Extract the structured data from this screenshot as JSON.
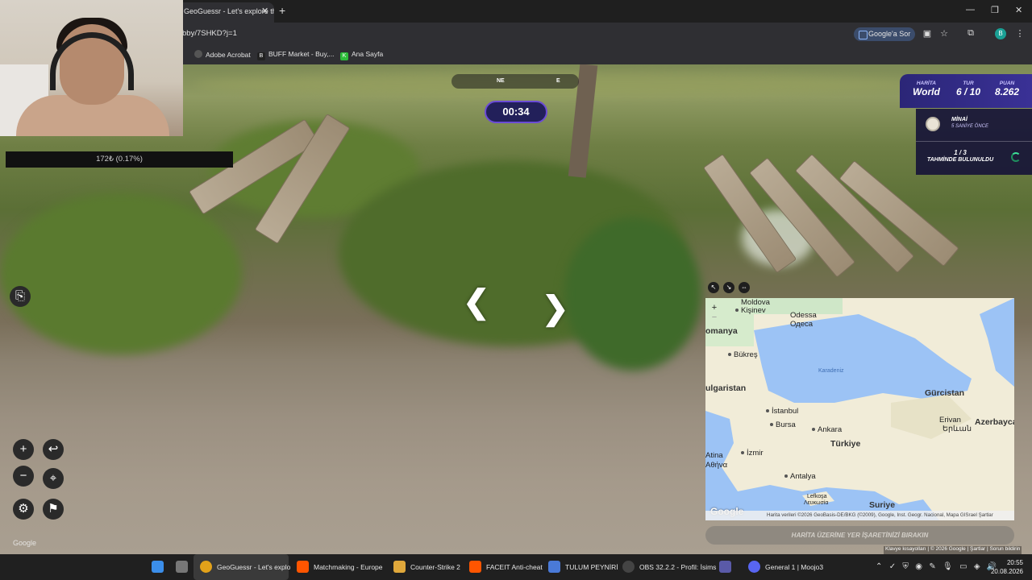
{
  "browser": {
    "tab_title": "GeoGuessr - Let's explore the w",
    "url": "bby/7SHKD?j=1",
    "google_sor": "Google'a Sor",
    "profile_initial": "B",
    "bookmarks": [
      "Adobe Acrobat",
      "BUFF Market - Buy,...",
      "Ana Sayfa"
    ]
  },
  "stream": {
    "progress_text": "172₺ (0.17%)"
  },
  "game": {
    "compass": [
      "NE",
      "E"
    ],
    "timer": "00:34",
    "hud": {
      "map_label": "HARİTA",
      "map_value": "World",
      "round_label": "TUR",
      "round_value": "6 / 10",
      "score_label": "PUAN",
      "score_value": "8.262"
    },
    "guesses": {
      "player_name": "MİNAİ",
      "player_time": "5 SANİYE ÖNCE",
      "fraction": "1 / 3",
      "found_text": "TAHMİNDE BULUNULDU"
    },
    "place_marker_button": "HARİTA ÜZERİNE YER İŞARETİNİZİ BIRAKIN",
    "google_watermark": "Google"
  },
  "map": {
    "labels": {
      "moldova": "Moldova",
      "kisinev": "Kişinev",
      "odessa": "Odessa",
      "odessa_cyr": "Одеса",
      "romanya": "omanya",
      "bukres": "Bükreş",
      "karadeniz": "Karadeniz",
      "bulgaristan": "ulgaristan",
      "gurcistan": "Gürcistan",
      "istanbul": "İstanbul",
      "bursa": "Bursa",
      "ankara": "Ankara",
      "erivan": "Erivan",
      "erivan_arm": "Երևան",
      "azerbaycan": "Azerbayca",
      "turkiye": "Türkiye",
      "atina": "Atina",
      "atina_gr": "Αθήνα",
      "izmir": "İzmir",
      "antalya": "Antalya",
      "lefkosa": "Lefkoşa",
      "lefkosa_gr": "Λευκωσία",
      "suriye": "Suriye"
    },
    "google_logo": "Google",
    "attribution": "Harita verileri ©2026 GeoBasis-DE/BKG (©2009), Google, Inst. Geogr. Nacional, Mapa GISrael   Şartlar",
    "street_attrib": "Klavye kısayolları  |  © 2026 Google  |  Şartlar  |  Sorun bildirin"
  },
  "taskbar": {
    "items": [
      "GeoGuessr - Let's explo",
      "Matchmaking - Europe",
      "Counter-Strike 2",
      "FACEIT Anti-cheat",
      "TULUM PEYNİRİ",
      "OBS 32.2.2 - Profil: İsims",
      "General 1 | Moojo3"
    ],
    "time": "20:55",
    "date": "20.08.2026"
  },
  "colors": {
    "hud_purple": "#2b2677",
    "timer_border": "#6b4bd6",
    "map_sea": "#9cc3f5",
    "map_land": "#f1ecd8"
  }
}
